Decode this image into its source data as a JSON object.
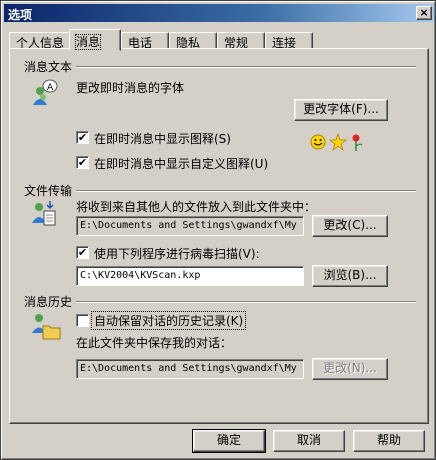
{
  "window": {
    "title": "选项",
    "close_glyph": "×"
  },
  "tabs": [
    {
      "label": "个人信息",
      "active": false
    },
    {
      "label": "消息",
      "active": true
    },
    {
      "label": "电话",
      "active": false
    },
    {
      "label": "隐私",
      "active": false
    },
    {
      "label": "常规",
      "active": false
    },
    {
      "label": "连接",
      "active": false
    }
  ],
  "messages": {
    "section_title": "消息文本",
    "change_font_text": "更改即时消息的字体",
    "change_font_button": "更改字体(F)...",
    "show_emoticons": {
      "label": "在即时消息中显示图释(S)",
      "checked": true
    },
    "show_custom_emoticons": {
      "label": "在即时消息中显示自定义图释(U)",
      "checked": true
    },
    "check_mark": "✔"
  },
  "file_transfer": {
    "section_title": "文件传输",
    "receive_folder_label": "将收到来自其他人的文件放入到此文件夹中：",
    "receive_folder_value": "E:\\Documents and Settings\\gwandxf\\My",
    "change_button": "更改(C)...",
    "virus_scan": {
      "label": "使用下列程序进行病毒扫描(V):",
      "checked": true
    },
    "virus_scan_path": "C:\\KV2004\\KVScan.kxp",
    "browse_button": "浏览(B)..."
  },
  "history": {
    "section_title": "消息历史",
    "auto_save": {
      "label": "自动保留对话的历史记录(K)",
      "checked": false
    },
    "save_folder_label": "在此文件夹中保存我的对话：",
    "save_folder_value": "E:\\Documents and Settings\\gwandxf\\My",
    "change_button": "更改(N)..."
  },
  "dialog_buttons": {
    "ok": "确定",
    "cancel": "取消",
    "help": "帮助"
  },
  "colors": {
    "titlebar_start": "#0a246a",
    "titlebar_end": "#a6caf0",
    "face": "#d4d0c8"
  }
}
